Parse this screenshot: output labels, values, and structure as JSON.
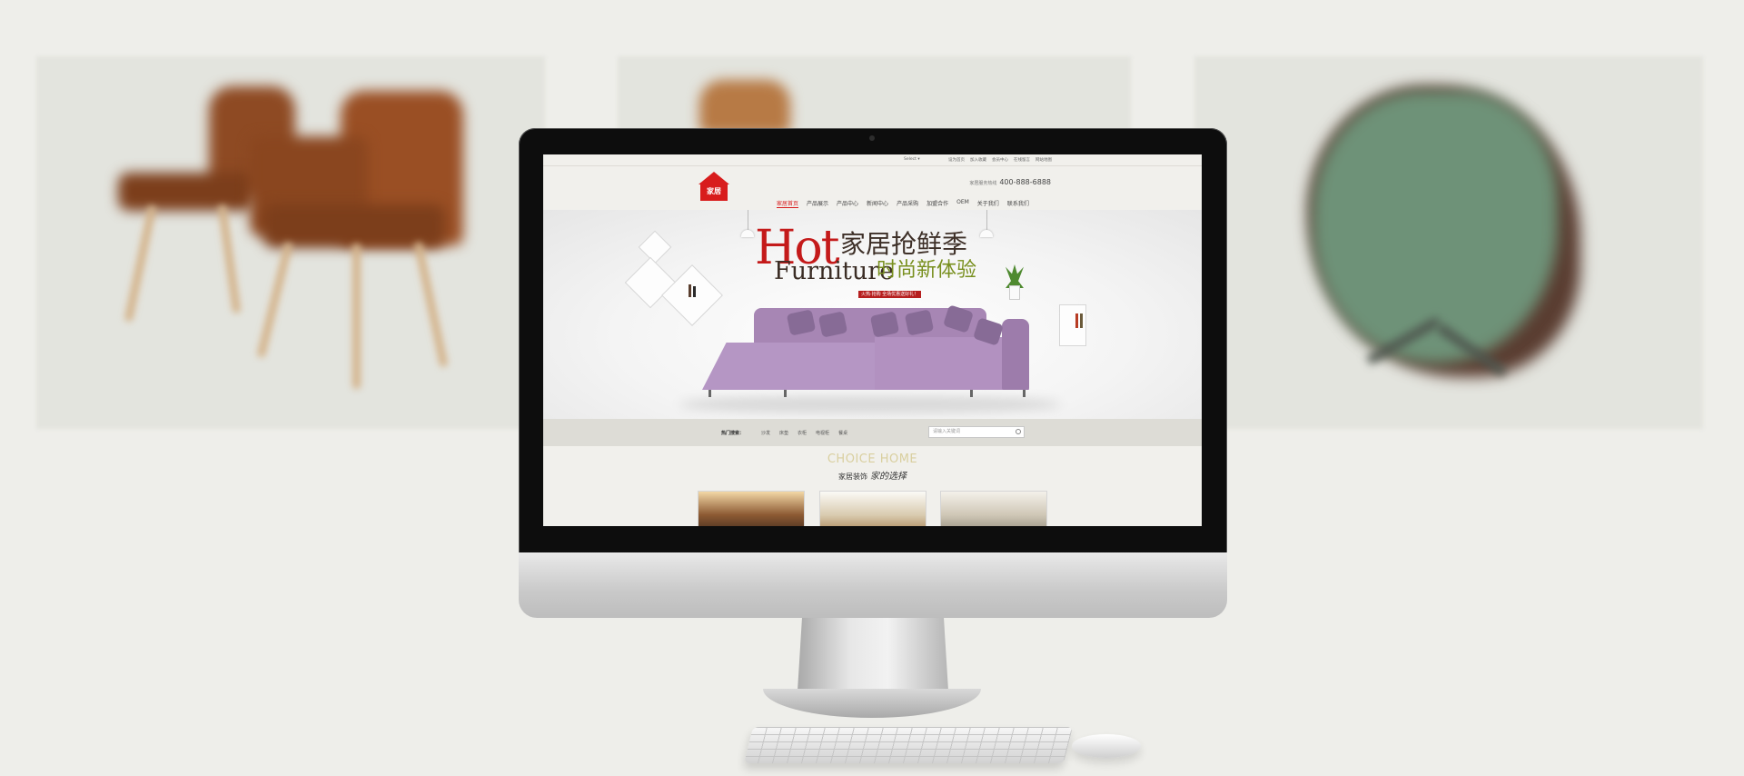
{
  "site": {
    "utility": {
      "lang": "Select ▾",
      "links": [
        "设为首页",
        "加入收藏",
        "会员中心",
        "在线留言",
        "网站地图"
      ]
    },
    "logo_text": "家居",
    "phone_label": "家居服务热线",
    "phone_number": "400-888-6888",
    "nav": [
      {
        "label": "家居首页",
        "active": true
      },
      {
        "label": "产品展示",
        "active": false
      },
      {
        "label": "产品中心",
        "active": false
      },
      {
        "label": "新闻中心",
        "active": false
      },
      {
        "label": "产品采购",
        "active": false
      },
      {
        "label": "加盟合作",
        "active": false
      },
      {
        "label": "OEM",
        "active": false
      },
      {
        "label": "关于我们",
        "active": false
      },
      {
        "label": "联系我们",
        "active": false
      }
    ],
    "banner": {
      "hot": "Hot",
      "furniture": "Furniture",
      "headline_1": "家居抢鲜季",
      "headline_2": "时尚新体验",
      "promo": "火热·抢购 全场优惠送好礼！"
    },
    "search": {
      "hot_label": "热门搜索：",
      "keywords": [
        "沙发",
        "床垫",
        "衣柜",
        "电视柜",
        "餐桌"
      ],
      "placeholder": "请输入关键词"
    },
    "section": {
      "title": "CHOICE HOME",
      "subtitle": "家居装饰",
      "subtitle_script": "家的选择"
    }
  },
  "colors": {
    "accent": "#d81c1c",
    "headline_green": "#788f1e",
    "sofa": "#b596c4",
    "page_bg": "#eeeeea"
  }
}
